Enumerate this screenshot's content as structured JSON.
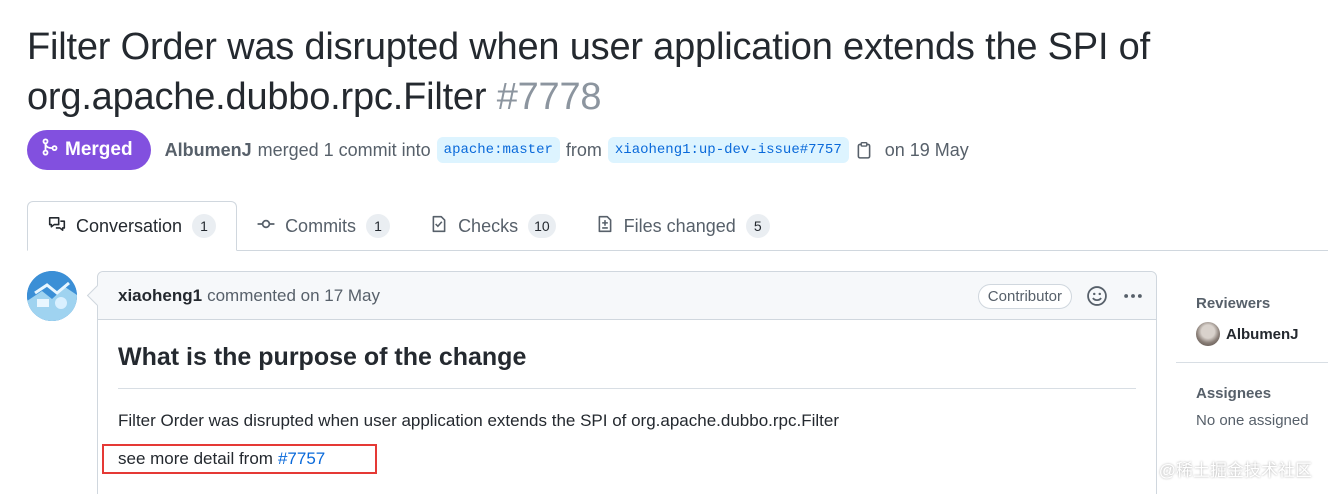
{
  "title": {
    "text": "Filter Order was disrupted when user application extends the SPI of org.apache.dubbo.rpc.Filter",
    "number": "#7778"
  },
  "meta": {
    "state_label": "Merged",
    "author": "AlbumenJ",
    "action_text": "merged 1 commit into",
    "base_branch": "apache:master",
    "from_text": "from",
    "head_branch": "xiaoheng1:up-dev-issue#7757",
    "date_text": "on 19 May"
  },
  "tabs": [
    {
      "label": "Conversation",
      "count": "1",
      "icon": "comment-discussion-icon"
    },
    {
      "label": "Commits",
      "count": "1",
      "icon": "git-commit-icon"
    },
    {
      "label": "Checks",
      "count": "10",
      "icon": "checklist-icon"
    },
    {
      "label": "Files changed",
      "count": "5",
      "icon": "file-diff-icon"
    }
  ],
  "comment": {
    "author": "xiaoheng1",
    "action": "commented on 17 May",
    "role_badge": "Contributor",
    "heading": "What is the purpose of the change",
    "paragraph": "Filter Order was disrupted when user application extends the SPI of org.apache.dubbo.rpc.Filter",
    "detail_prefix": "see more detail from",
    "detail_link": "#7757"
  },
  "sidebar": {
    "reviewers_title": "Reviewers",
    "reviewer_name": "AlbumenJ",
    "assignees_title": "Assignees",
    "assignees_empty": "No one assigned"
  },
  "watermark": "@稀土掘金技术社区",
  "colors": {
    "merged": "#8250df",
    "link": "#0969da",
    "branch_bg": "#ddf4ff",
    "highlight_box": "#e53935"
  }
}
